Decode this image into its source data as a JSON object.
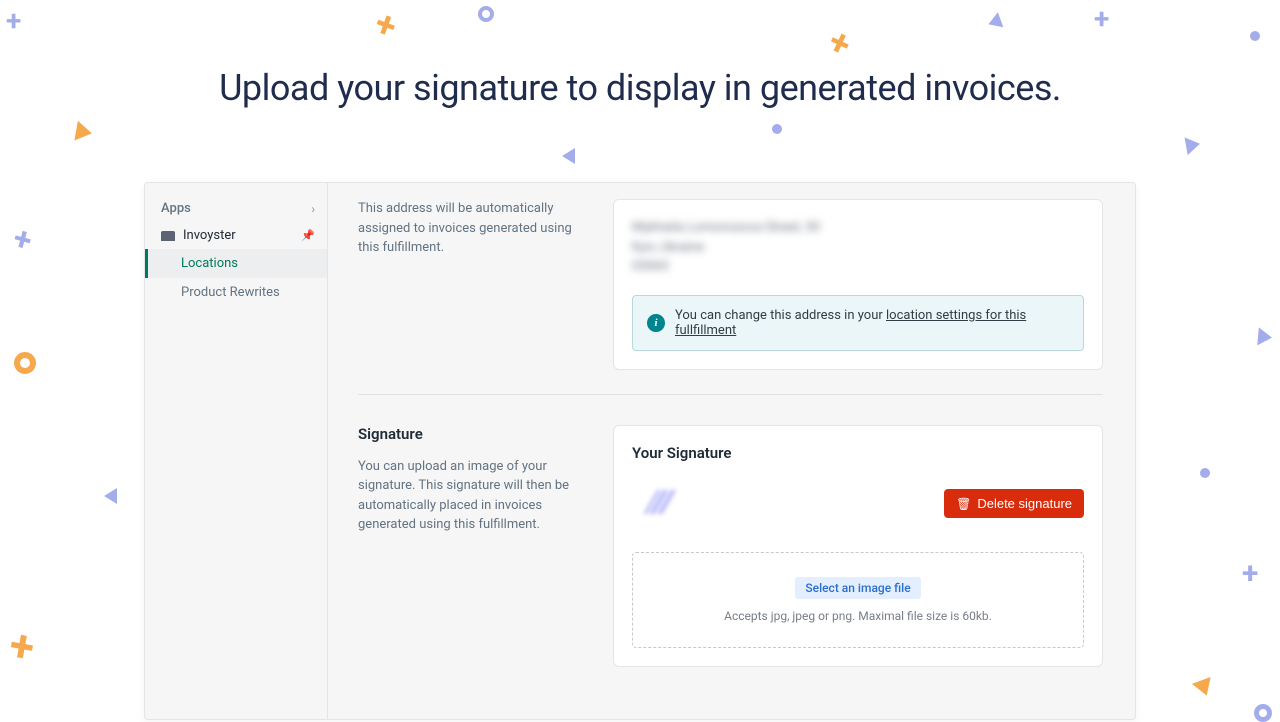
{
  "hero": {
    "title": "Upload your signature to display in generated invoices."
  },
  "sidebar": {
    "apps_label": "Apps",
    "app_name": "Invoyster",
    "items": [
      {
        "label": "Locations",
        "active": true
      },
      {
        "label": "Product Rewrites",
        "active": false
      }
    ]
  },
  "address_section": {
    "description": "This address will be automatically assigned to invoices generated using this fulfillment.",
    "blurred_lines": "Mykhaila Lomonosova Street, 50\nKyiv, Ukraine\n03065",
    "info_text_prefix": "You can change this address in your ",
    "info_link": "location settings for this fullfillment"
  },
  "signature_section": {
    "heading": "Signature",
    "description": "You can upload an image of your signature. This signature will then be automatically placed in invoices generated using this fulfillment.",
    "card_heading": "Your Signature",
    "delete_label": "Delete signature",
    "select_file_label": "Select an image file",
    "upload_hint": "Accepts jpg, jpeg or png. Maximal file size is 60kb."
  }
}
